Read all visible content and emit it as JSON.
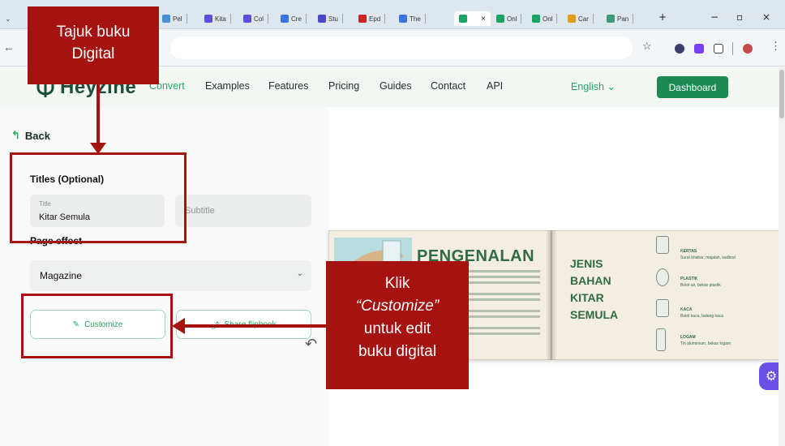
{
  "browser": {
    "tabs": [
      {
        "label": "Pel",
        "color": "#4a8fd6"
      },
      {
        "label": "Kita",
        "color": "#5b4ee0"
      },
      {
        "label": "Col",
        "color": "#5b4ee0"
      },
      {
        "label": "Cre",
        "color": "#3b73e0"
      },
      {
        "label": "Stu",
        "color": "#4a49c9"
      },
      {
        "label": "Epd",
        "color": "#c9232b"
      },
      {
        "label": "The",
        "color": "#3b73e0"
      },
      {
        "label": "",
        "color": "#19a463",
        "active": true
      },
      {
        "label": "Onl",
        "color": "#19a463"
      },
      {
        "label": "Onl",
        "color": "#19a463"
      },
      {
        "label": "Car",
        "color": "#e09a1c"
      },
      {
        "label": "Pan",
        "color": "#3d9a78"
      }
    ],
    "new_tab": "+",
    "minimize": "−",
    "maximize": "▫",
    "close": "×",
    "back_icon": "←"
  },
  "site": {
    "logo": "Heyzine",
    "nav": [
      "Convert",
      "Examples",
      "Features",
      "Pricing",
      "Guides",
      "Contact",
      "API"
    ],
    "active_nav": "Convert",
    "language": "English",
    "dashboard_label": "Dashboard"
  },
  "editor": {
    "back_label": "Back",
    "titles_heading": "Titles (Optional)",
    "title_label": "Title",
    "title_value": "Kitar Semula",
    "subtitle_placeholder": "Subtitle",
    "page_effect_heading": "Page effect",
    "page_effect_value": "Magazine",
    "customize_label": "Customize",
    "share_label": "Share flipbook"
  },
  "preview": {
    "left_heading": "PENGENALAN",
    "right_heading_lines": [
      "JENIS",
      "BAHAN",
      "KITAR",
      "SEMULA"
    ],
    "items": [
      {
        "label": "KERTAS",
        "desc": "Surat khabar, majalah, kadbod"
      },
      {
        "label": "PLASTIK",
        "desc": "Botol air, bekas plastik"
      },
      {
        "label": "KACA",
        "desc": "Botol kaca, balang kaca"
      },
      {
        "label": "LOGAM",
        "desc": "Tin aluminium, bekas logam"
      }
    ]
  },
  "annotations": {
    "callout1": [
      "Tajuk buku",
      "Digital"
    ],
    "callout2_line1": "Klik",
    "callout2_line2": "“Customize”",
    "callout2_line3": "untuk edit",
    "callout2_line4": "buku digital",
    "color": "#a5120f"
  }
}
